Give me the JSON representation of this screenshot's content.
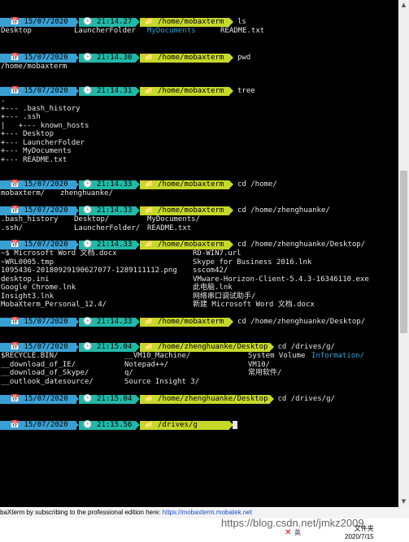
{
  "prompts": [
    {
      "date": "15/07/2020",
      "time": "21:14.27",
      "path": "/home/mobaxterm",
      "cmd": "ls"
    },
    {
      "date": "15/07/2020",
      "time": "21:14.30",
      "path": "/home/mobaxterm",
      "cmd": "pwd"
    },
    {
      "date": "15/07/2020",
      "time": "21:14.31",
      "path": "/home/mobaxterm",
      "cmd": "tree"
    },
    {
      "date": "15/07/2020",
      "time": "21:14.33",
      "path": "/home/mobaxterm",
      "cmd": "cd /home/"
    },
    {
      "date": "15/07/2020",
      "time": "21:14.33",
      "path": "/home/mobaxterm",
      "cmd": "cd /home/zhenghuanke/"
    },
    {
      "date": "15/07/2020",
      "time": "21:14.33",
      "path": "/home/mobaxterm",
      "cmd": "cd /home/zhenghuanke/Desktop/"
    },
    {
      "date": "15/07/2020",
      "time": "21:14.33",
      "path": "/home/mobaxterm",
      "cmd": "cd /home/zhenghuanke/Desktop/"
    },
    {
      "date": "15/07/2020",
      "time": "21:15.04",
      "path": "/home/zhenghuanke/Desktop",
      "cmd": "cd /drives/g/"
    },
    {
      "date": "15/07/2020",
      "time": "21:15.04",
      "path": "/home/zhenghuanke/Desktop",
      "cmd": "cd /drives/g/"
    },
    {
      "date": "15/07/2020",
      "time": "21:15.56",
      "path": "/drives/g",
      "cmd": ""
    }
  ],
  "output": {
    "ls": [
      "Desktop",
      "LauncherFolder",
      "MyDocuments",
      "README.txt"
    ],
    "pwd": "/home/mobaxterm",
    "tree": [
      ".",
      "+--- .bash_history",
      "+--- .ssh",
      "|   +--- known_hosts",
      "+--- Desktop",
      "+--- LauncherFolder",
      "+--- MyDocuments",
      "+--- README.txt"
    ],
    "home_completion": [
      "mobaxterm/",
      "zhenghuanke/"
    ],
    "zh_completion": [
      ".bash_history",
      "Desktop/",
      "MyDocuments/",
      ".ssh/",
      "LauncherFolder/",
      "README.txt"
    ],
    "desktop_completion": [
      "~$ Microsoft Word 文档.docx",
      "RD-WIN7.url",
      "~WRL0005.tmp",
      "Skype for Business 2016.lnk",
      "1095436-20180929190627077-1289111112.png",
      "sscom42/",
      "desktop.ini",
      "VMware-Horizon-Client-5.4.3-16346110.exe",
      "Google Chrome.lnk",
      "此电脑.lnk",
      "Insight3.lnk",
      "网络串口调试助手/",
      "MobaXterm_Personal_12.4/",
      "新建 Microsoft Word 文档.docx"
    ],
    "drives_completion": [
      "$RECYCLE.BIN/",
      "__VM10_Machine/",
      "System Volume",
      "Information/",
      "__download_of_IE/",
      "Notepad++/",
      "VM10/",
      "__download_of_Skype/",
      "q/",
      "常用软件/",
      "__outlook_datesource/",
      "Source Insight 3/"
    ]
  },
  "statusbar": {
    "text": "baXterm by subscribing to the professional edition here:  ",
    "link": "https://mobaxterm.mobatek.net"
  },
  "taskbar": {
    "watermark": "https://blog.csdn.net/jmkz2009",
    "tray_text": "英",
    "clock_time": "文件夹",
    "clock_date": "2020/7/15"
  },
  "icons": {
    "folder": "📁",
    "calendar": "📅",
    "clock": "🕒",
    "scroll_up": "▲",
    "scroll_down": "▼",
    "close": "✕"
  },
  "colors": {
    "date_bg": "#3aa0d3",
    "time_bg": "#22b8a6",
    "path_bg": "#c6d82a",
    "text": "#e6e6e6"
  }
}
